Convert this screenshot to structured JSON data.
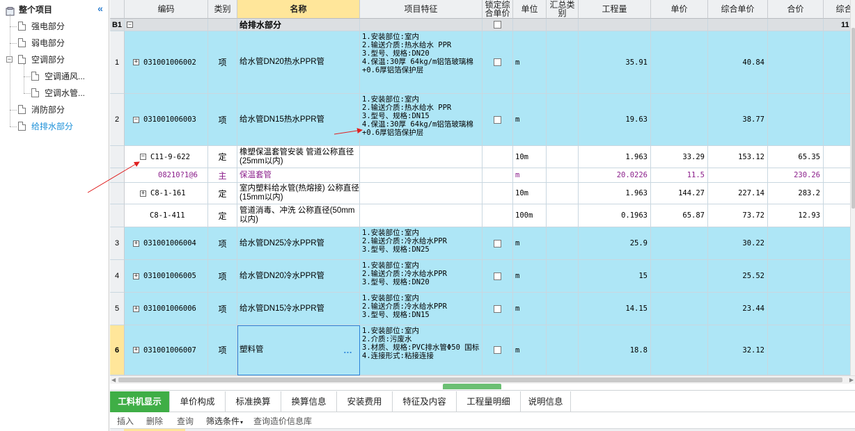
{
  "tree": {
    "root": "整个项目",
    "items": [
      "强电部分",
      "弱电部分",
      "空调部分",
      "空调通风...",
      "空调水管...",
      "消防部分",
      "给排水部分"
    ]
  },
  "grid": {
    "headers": {
      "code": "编码",
      "category": "类别",
      "name": "名称",
      "feature": "项目特征",
      "lock": "锁定综合单价",
      "unit": "单位",
      "summary": "汇总类别",
      "qty": "工程量",
      "price": "单价",
      "comp_price": "综合单价",
      "total": "合价",
      "comp_total": "综合"
    },
    "section": {
      "num": "B1",
      "name": "给排水部分",
      "extra": "11"
    },
    "rows": [
      {
        "num": "1",
        "code": "031001006002",
        "cat": "项",
        "name": "给水管DN20热水PPR管",
        "feature": "1.安装部位:室内\n2.输送介质:热水给水 PPR\n3.型号、规格:DN20\n4.保温:30厚 64kg/m铝箔玻璃棉+0.6厚铝箔保护层",
        "unit": "m",
        "qty": "35.91",
        "price": "",
        "comp_price": "40.84",
        "total": ""
      },
      {
        "num": "2",
        "code": "031001006003",
        "cat": "项",
        "name": "给水管DN15热水PPR管",
        "feature": "1.安装部位:室内\n2.输送介质:热水给水 PPR\n3.型号、规格:DN15\n4.保温:30厚 64kg/m铝箔玻璃棉+0.6厚铝箔保护层",
        "unit": "m",
        "qty": "19.63",
        "price": "",
        "comp_price": "38.77",
        "total": ""
      },
      {
        "num": "",
        "code": "C11-9-622",
        "cat": "定",
        "name": "橡塑保温套管安装 管道公称直径(25mm以内)",
        "feature": "",
        "unit": "10m",
        "qty": "1.963",
        "price": "33.29",
        "comp_price": "153.12",
        "total": "65.35"
      },
      {
        "num": "",
        "code": "08210?1@6",
        "cat": "主",
        "name": "保温套管",
        "feature": "",
        "unit": "m",
        "qty": "20.0226",
        "price": "11.5",
        "comp_price": "",
        "total": "230.26"
      },
      {
        "num": "",
        "code": "C8-1-161",
        "cat": "定",
        "name": "室内塑料给水管(热熔接) 公称直径(15mm以内)",
        "feature": "",
        "unit": "10m",
        "qty": "1.963",
        "price": "144.27",
        "comp_price": "227.14",
        "total": "283.2"
      },
      {
        "num": "",
        "code": "C8-1-411",
        "cat": "定",
        "name": "管道消毒、冲洗 公称直径(50mm以内)",
        "feature": "",
        "unit": "100m",
        "qty": "0.1963",
        "price": "65.87",
        "comp_price": "73.72",
        "total": "12.93"
      },
      {
        "num": "3",
        "code": "031001006004",
        "cat": "项",
        "name": "给水管DN25冷水PPR管",
        "feature": "1.安装部位:室内\n2.输送介质:冷水给水PPR\n3.型号、规格:DN25",
        "unit": "m",
        "qty": "25.9",
        "price": "",
        "comp_price": "30.22",
        "total": ""
      },
      {
        "num": "4",
        "code": "031001006005",
        "cat": "项",
        "name": "给水管DN20冷水PPR管",
        "feature": "1.安装部位:室内\n2.输送介质:冷水给水PPR\n3.型号、规格:DN20",
        "unit": "m",
        "qty": "15",
        "price": "",
        "comp_price": "25.52",
        "total": ""
      },
      {
        "num": "5",
        "code": "031001006006",
        "cat": "项",
        "name": "给水管DN15冷水PPR管",
        "feature": "1.安装部位:室内\n2.输送介质:冷水给水PPR\n3.型号、规格:DN15",
        "unit": "m",
        "qty": "14.15",
        "price": "",
        "comp_price": "23.44",
        "total": ""
      },
      {
        "num": "6",
        "code": "031001006007",
        "cat": "项",
        "name": "塑料管",
        "feature": "1.安装部位:室内\n2.介质:污废水\n3.材质、规格:PVC排水管Φ50 国标\n4.连接形式:粘接连接",
        "unit": "m",
        "qty": "18.8",
        "price": "",
        "comp_price": "32.12",
        "total": ""
      }
    ]
  },
  "tabs": [
    "工料机显示",
    "单价构成",
    "标准换算",
    "换算信息",
    "安装费用",
    "特征及内容",
    "工程量明细",
    "说明信息"
  ],
  "toolbar": [
    "插入",
    "删除",
    "查询",
    "筛选条件",
    "查询造价信息库"
  ],
  "colors": {
    "row_blue": "#aee6f6",
    "active_tab": "#3fae46",
    "name_header": "#ffe69a",
    "main_material": "#8b1f8b",
    "annotation": "#e02020"
  }
}
